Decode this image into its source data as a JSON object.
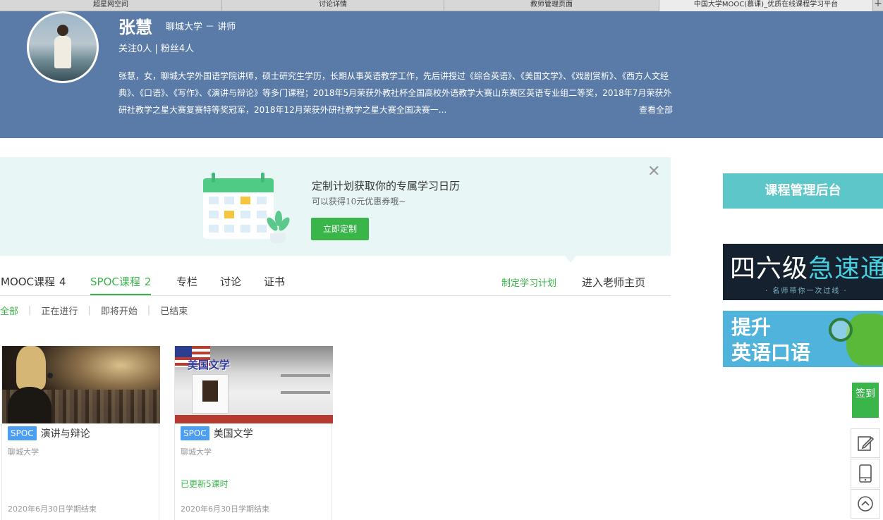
{
  "browser": {
    "tabs": [
      {
        "label": "超星网空间"
      },
      {
        "label": "讨论详情"
      },
      {
        "label": "教师管理页面"
      },
      {
        "label": "中国大学MOOC(慕课)_优质在线课程学习平台"
      }
    ],
    "plus": "+"
  },
  "profile": {
    "name": "张慧",
    "affiliation": "聊城大学 － 讲师",
    "follow": "关注0人 | 粉丝4人",
    "bio": "张慧，女，聊城大学外国语学院讲师，硕士研究生学历，长期从事英语教学工作，先后讲授过《综合英语》、《美国文学》、《戏剧赏析》、《西方人文经典》、《口语》、《写作》、《演讲与辩论》等多门课程；2018年5月荣获外教社杯全国高校外语教学大赛山东赛区英语专业组二等奖，2018年7月荣获外研社教学之星大赛复赛特等奖冠军，2018年12月荣获外研社教学之星大赛全国决赛一...",
    "more": "查看全部"
  },
  "promo": {
    "title": "定制计划获取你的专属学习日历",
    "subtitle": "可以获得10元优惠券哦~",
    "button": "立即定制",
    "close": "✕"
  },
  "tabs": [
    {
      "label": "MOOC课程",
      "count": "4"
    },
    {
      "label": "SPOC课程",
      "count": "2"
    },
    {
      "label": "专栏",
      "count": ""
    },
    {
      "label": "讨论",
      "count": ""
    },
    {
      "label": "证书",
      "count": ""
    }
  ],
  "links": {
    "plan": "制定学习计划",
    "teacher": "进入老师主页"
  },
  "filters": [
    {
      "label": "全部"
    },
    {
      "label": "正在进行"
    },
    {
      "label": "即将开始"
    },
    {
      "label": "已结束"
    }
  ],
  "filter_sep": "|",
  "courses": [
    {
      "badge": "SPOC",
      "title": "演讲与辩论",
      "school": "聊城大学",
      "update": "",
      "end": "2020年6月30日学期结束"
    },
    {
      "badge": "SPOC",
      "title": "美国文学",
      "school": "聊城大学",
      "update": "已更新5课时",
      "end": "2020年6月30日学期结束",
      "thumb_title": "美国文学"
    }
  ],
  "sidebar": {
    "admin": "课程管理后台",
    "ad1_text": "四六级",
    "ad1_highlight": "急速通关",
    "ad1_small": "· 名师带你一次过线 ·",
    "ad2_line1": "提升",
    "ad2_line2": "英语口语",
    "checkin": "签到"
  },
  "colors": {
    "header_bg": "#5a7ba7",
    "accent_green": "#3ab54a",
    "spoc_blue": "#4a9ff5",
    "admin_teal": "#5cc6c8"
  }
}
